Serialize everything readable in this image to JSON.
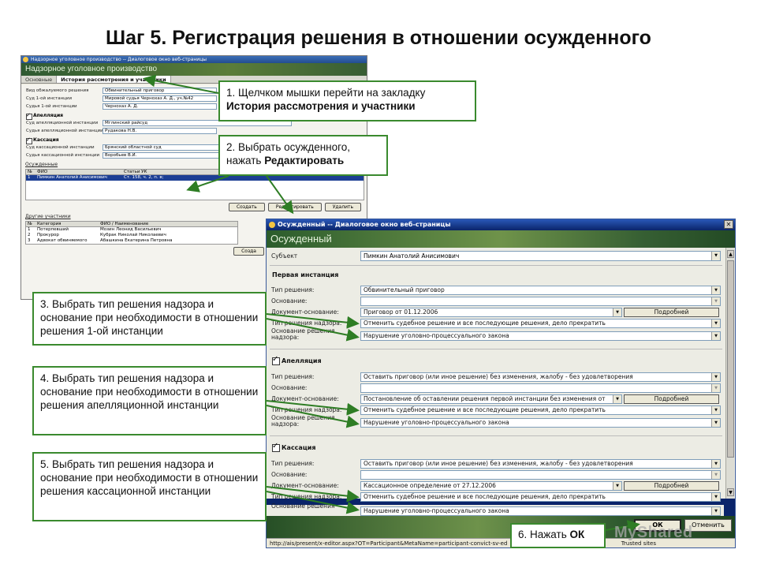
{
  "slide_title": "Шаг 5. Регистрация решения в отношении осужденного",
  "main_window": {
    "title": "Надзорное уголовное производство -- Диалоговое окно веб-страницы",
    "banner": "Надзорное уголовное производство",
    "tabs": [
      {
        "label": "Основные"
      },
      {
        "label": "История рассмотрения и участники",
        "active": true
      }
    ],
    "fields_top": [
      {
        "label": "Вид обжалуемого решения",
        "value": "Обвинительный приговор"
      },
      {
        "label": "Суд 1-ой инстанции",
        "value": "Мировой судья Чернохаз А. Д., уч.№42"
      },
      {
        "label": "Судья 1-ой инстанции",
        "value": "Чернохаз А. Д."
      }
    ],
    "appeal_label": "Апелляция",
    "fields_appeal": [
      {
        "label": "Суд апелляционной инстанции",
        "value": "Мглинский райсуд"
      },
      {
        "label": "Судья апелляционной инстанции",
        "value": "Рудакова Н.В."
      }
    ],
    "cassation_label": "Кассация",
    "fields_cassation": [
      {
        "label": "Суд кассационной инстанции",
        "value": "Брянский областной суд"
      },
      {
        "label": "Судья кассационной инстанции",
        "value": "Воробьев В.И."
      }
    ],
    "convicts_section": "Осужденные",
    "convicts_headers": [
      "№",
      "ФИО",
      "Статьи УК"
    ],
    "convicts_rows": [
      [
        "1",
        "Пимкин Анатолий Анисимович",
        "Ст. 158, ч. 2, п. в;"
      ]
    ],
    "convicts_buttons": {
      "create": "Создать",
      "edit": "Редактировать",
      "delete": "Удалить"
    },
    "others_section": "Другие участники",
    "others_headers": [
      "№",
      "Категория",
      "ФИО / Наименование"
    ],
    "others_rows": [
      [
        "1",
        "Потерпевший",
        "Мозин Леонид Васильевич"
      ],
      [
        "2",
        "Прокурор",
        "Кубрак Николай Николаевич"
      ],
      [
        "3",
        "Адвокат обвиняемого",
        "Абашкина Екатерина Петровна"
      ]
    ],
    "others_create": "Созда"
  },
  "dialog": {
    "title": "Осужденный -- Диалоговое окно веб-страницы",
    "banner": "Осужденный",
    "subject": {
      "label": "Субъект",
      "value": "Пимкин Анатолий Анисимович"
    },
    "labels": {
      "decision_type": "Тип решения:",
      "basis": "Основание:",
      "doc_basis": "Документ-основание:",
      "supervision_type": "Тип решения надзора:",
      "supervision_basis_1": "Основание решения",
      "supervision_basis_2": "надзора:",
      "details": "Подробней"
    },
    "first_instance": {
      "heading": "Первая инстанция",
      "decision_type": "Обвинительный приговор",
      "basis": "",
      "doc_basis": "Приговор от 01.12.2006",
      "supervision_type": "Отменить судебное решение и все последующие решения, дело прекратить",
      "supervision_basis": "Нарушение уголовно-процессуального закона"
    },
    "appeal": {
      "heading": "Апелляция",
      "decision_type": "Оставить приговор (или иное решение) без изменения, жалобу - без удовлетворения",
      "basis": "",
      "doc_basis": "Постановление об оставлении решения первой инстанции без изменения от",
      "supervision_type": "Отменить судебное решение и все последующие решения, дело прекратить",
      "supervision_basis": "Нарушение уголовно-процессуального закона"
    },
    "cassation": {
      "heading": "Кассация",
      "decision_type": "Оставить приговор (или иное решение) без изменения, жалобу - без удовлетворения",
      "basis": "",
      "doc_basis": "Кассационное определение от 27.12.2006",
      "supervision_type": "Отменить судебное решение и все последующие решения, дело прекратить",
      "supervision_basis": "Нарушение уголовно-процессуального закона"
    },
    "ok": "ОК",
    "cancel": "Отменить",
    "status_url": "http://ais/present/x-editor.aspx?OT=Participant&MetaName=participant-convict-sv-ed",
    "status_trusted": "Trusted sites"
  },
  "callouts": {
    "c1_line1": "1. Щелчком мышки перейти на закладку",
    "c1_line2": "История рассмотрения и участники",
    "c2_line1": "2. Выбрать осужденного,",
    "c2_line2a": "нажать ",
    "c2_line2b": "Редактировать",
    "c3": "3. Выбрать тип решения надзора и основание при необходимости в отношении решения 1-ой инстанции",
    "c4": "4. Выбрать тип решения надзора и основание при необходимости в отношении решения апелляционной инстанции",
    "c5": "5. Выбрать тип решения надзора и основание при необходимости в отношении решения кассационной инстанции",
    "c6a": "6. Нажать ",
    "c6b": "ОК"
  },
  "watermark": "MyShared",
  "colors": {
    "callout_border": "#3a8a2e",
    "banner_green": "#5b7d3a",
    "selection": "#1c3f94"
  }
}
